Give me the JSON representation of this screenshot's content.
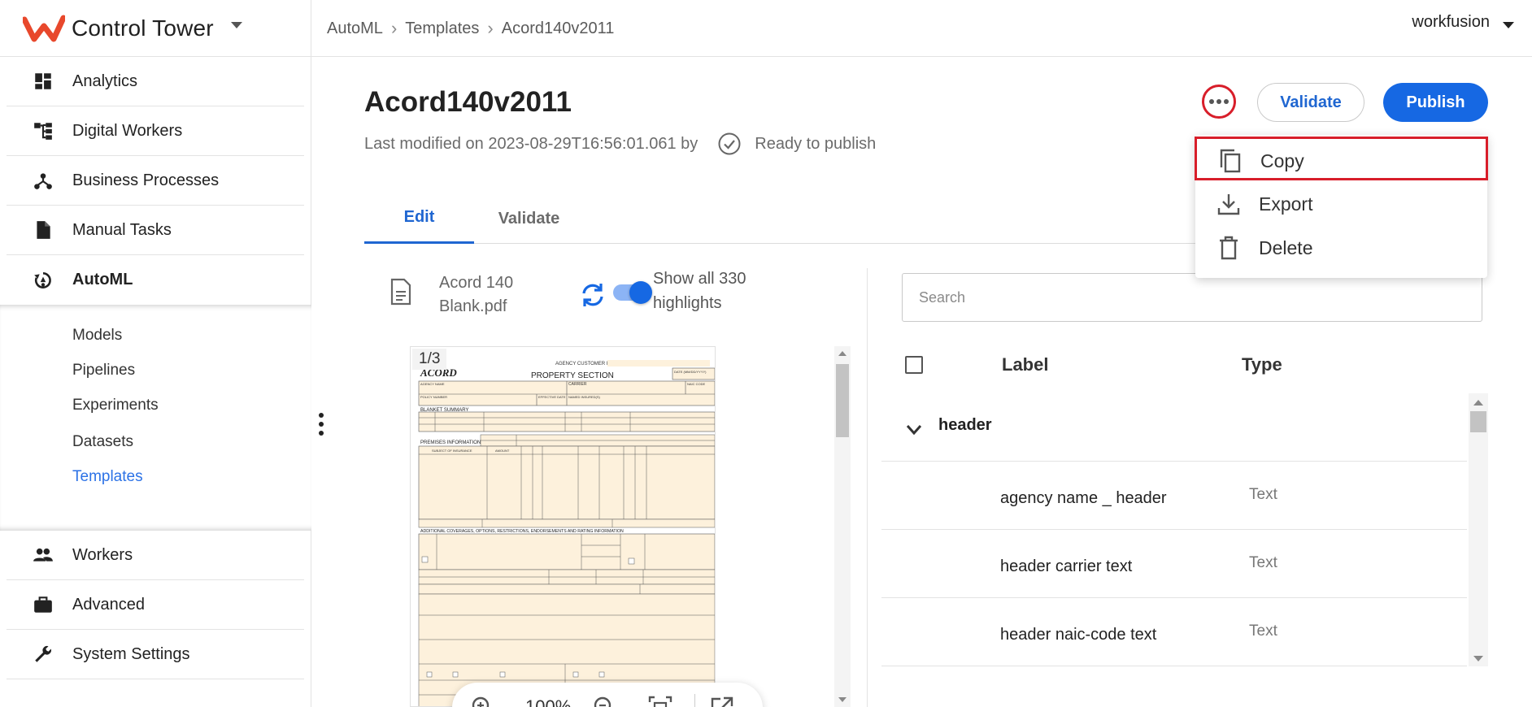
{
  "app": {
    "name": "Control Tower"
  },
  "breadcrumb": [
    "AutoML",
    "Templates",
    "Acord140v2011"
  ],
  "user": {
    "name": "workfusion"
  },
  "sidebar": {
    "items": [
      {
        "label": "Analytics",
        "icon": "dashboard-icon"
      },
      {
        "label": "Digital Workers",
        "icon": "hierarchy-icon"
      },
      {
        "label": "Business Processes",
        "icon": "process-icon"
      },
      {
        "label": "Manual Tasks",
        "icon": "document-icon"
      },
      {
        "label": "AutoML",
        "icon": "automl-icon"
      },
      {
        "label": "Workers",
        "icon": "people-icon"
      },
      {
        "label": "Advanced",
        "icon": "briefcase-icon"
      },
      {
        "label": "System Settings",
        "icon": "wrench-icon"
      }
    ],
    "subitems": [
      "Models",
      "Pipelines",
      "Experiments",
      "Datasets",
      "Templates"
    ],
    "active_item": "AutoML",
    "active_subitem": "Templates"
  },
  "page": {
    "title": "Acord140v2011",
    "last_modified": "Last modified on 2023-08-29T16:56:01.061 by",
    "status": "Ready to publish"
  },
  "actions": {
    "validate_label": "Validate",
    "publish_label": "Publish"
  },
  "menu": {
    "items": [
      "Copy",
      "Export",
      "Delete"
    ]
  },
  "tabs": [
    {
      "label": "Edit",
      "active": true
    },
    {
      "label": "Validate",
      "active": false
    }
  ],
  "document": {
    "file_name": "Acord 140 Blank.pdf",
    "highlights_label": "Show all 330 highlights",
    "page_indicator": "1/3",
    "zoom": "100%",
    "show_highlights": true
  },
  "labels": {
    "search_placeholder": "Search",
    "columns": [
      "Label",
      "Type"
    ],
    "group": "header",
    "rows": [
      {
        "name": "agency name _ header",
        "type": "Text"
      },
      {
        "name": "header carrier text",
        "type": "Text"
      },
      {
        "name": "header naic-code text",
        "type": "Text"
      }
    ]
  },
  "form_preview": {
    "texts": [
      "AGENCY CUSTOMER ID:",
      "ACORD",
      "PROPERTY SECTION",
      "DATE (MM/DD/YYYY)",
      "AGENCY NAME",
      "CARRIER",
      "NAIC CODE",
      "POLICY NUMBER",
      "EFFECTIVE DATE",
      "NAMED INSURED(S)",
      "BLANKET SUMMARY",
      "PREMISES INFORMATION",
      "SUBJECT OF INSURANCE",
      "AMOUNT",
      "ADDITIONAL COVERAGES, OPTIONS, RESTRICTIONS, ENDORSEMENTS AND RATING INFORMATION"
    ]
  },
  "colors": {
    "accent": "#1668e3",
    "highlight_red": "#d81e2a",
    "active_sub": "#2c72e6",
    "form_fill": "#fdf1dc"
  }
}
